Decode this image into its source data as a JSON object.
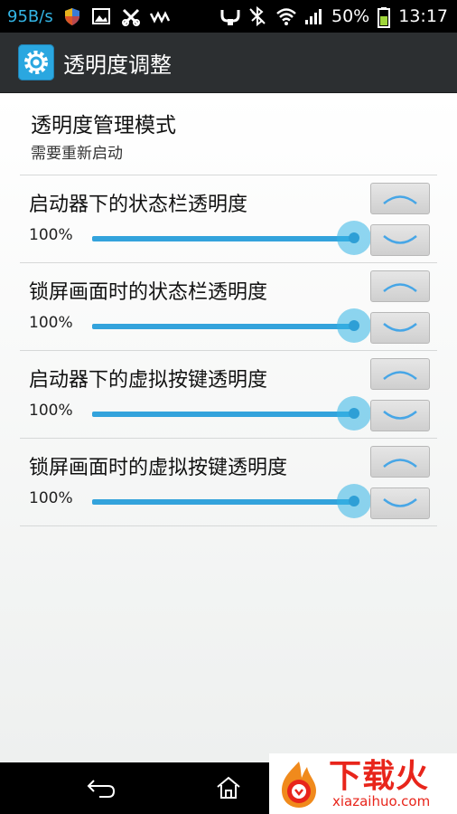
{
  "status_bar": {
    "speed": "95B/s",
    "battery": "50%",
    "time": "13:17",
    "left_icons": [
      "shield-icon",
      "image-icon",
      "tools-icon",
      "walkman-icon"
    ],
    "right_icons": [
      "usb-icon",
      "bluetooth-off-icon",
      "wifi-icon",
      "signal-icon",
      "battery-icon"
    ]
  },
  "action_bar": {
    "title": "透明度调整",
    "icon": "settings-icon"
  },
  "header": {
    "title": "透明度管理模式",
    "subtitle": "需要重新启动"
  },
  "items": [
    {
      "label": "启动器下的状态栏透明度",
      "value_text": "100%",
      "value": 100
    },
    {
      "label": "锁屏画面时的状态栏透明度",
      "value_text": "100%",
      "value": 100
    },
    {
      "label": "启动器下的虚拟按键透明度",
      "value_text": "100%",
      "value": 100
    },
    {
      "label": "锁屏画面时的虚拟按键透明度",
      "value_text": "100%",
      "value": 100
    }
  ],
  "nav_bar": {
    "icons": [
      "back-icon",
      "home-icon"
    ]
  },
  "watermark": {
    "main": "下载火",
    "sub": "xiazaihuo.com"
  },
  "colors": {
    "accent": "#33b5e5",
    "action_bar": "#2c2f31",
    "watermark": "#e8251b"
  }
}
